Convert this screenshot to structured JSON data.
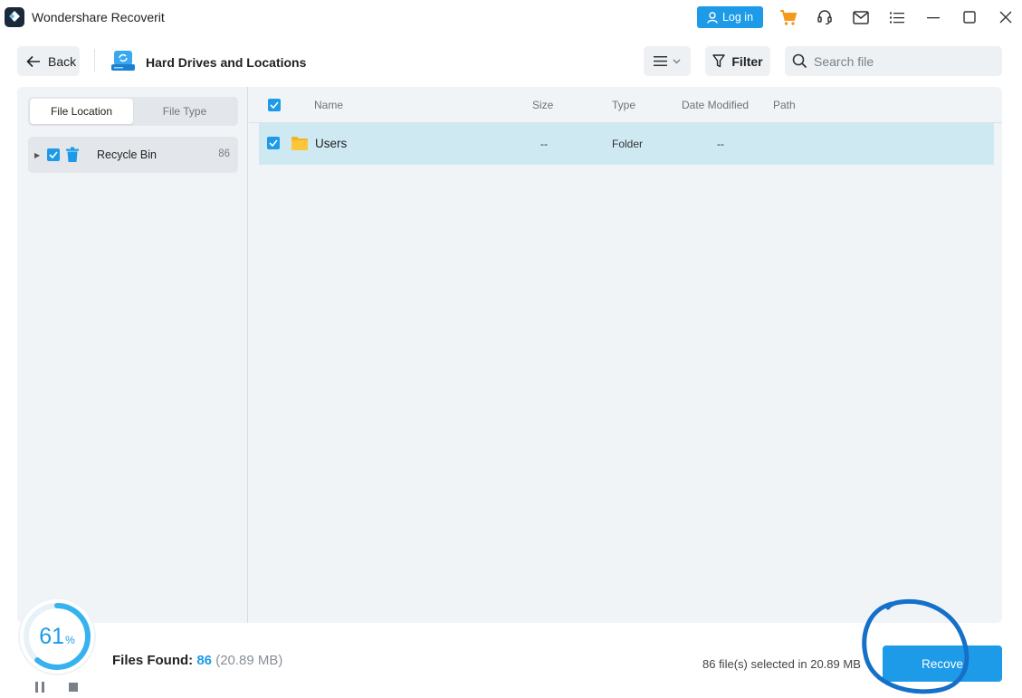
{
  "app": {
    "title": "Wondershare Recoverit",
    "login_label": "Log in",
    "icons": [
      "cart-icon",
      "headset-icon",
      "mail-icon",
      "menu-list-icon",
      "minimize-icon",
      "maximize-icon",
      "close-icon"
    ]
  },
  "toolbar": {
    "back_label": "Back",
    "location_title": "Hard Drives and Locations",
    "filter_label": "Filter",
    "search_placeholder": "Search file"
  },
  "sidebar": {
    "tabs": [
      {
        "label": "File Location",
        "active": true
      },
      {
        "label": "File Type",
        "active": false
      }
    ],
    "tree": [
      {
        "label": "Recycle Bin",
        "count": "86",
        "checked": true
      }
    ]
  },
  "table": {
    "headers": {
      "name": "Name",
      "size": "Size",
      "type": "Type",
      "date": "Date Modified",
      "path": "Path"
    },
    "rows": [
      {
        "name": "Users",
        "size": "--",
        "type": "Folder",
        "date": "--",
        "path": "",
        "checked": true
      }
    ]
  },
  "status": {
    "progress_percent": 61,
    "progress_value": "61",
    "percent_sign": "%",
    "files_found_label": "Files Found:",
    "files_found_count": "86",
    "files_found_size": "(20.89 MB)",
    "selected_text": "86 file(s) selected in 20.89 MB",
    "recover_label": "Recove"
  },
  "colors": {
    "accent": "#1d9be8",
    "selected_row": "#cfe9f3",
    "panel_bg": "#f1f4f7",
    "annotation": "#1570c8"
  }
}
